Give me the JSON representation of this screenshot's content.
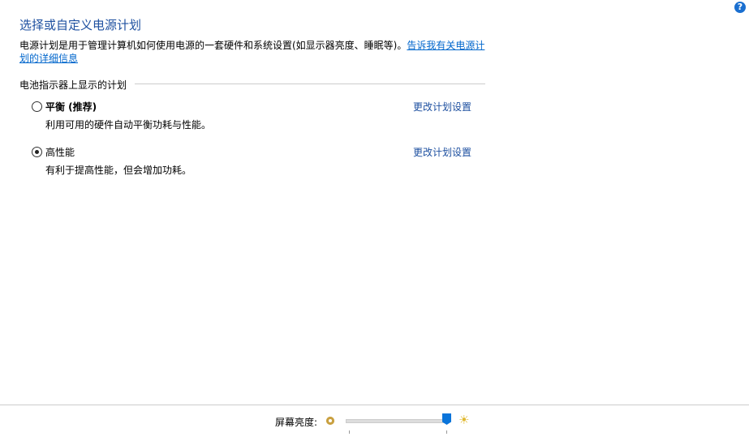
{
  "header": {
    "title": "选择或自定义电源计划",
    "help_icon": "?"
  },
  "description": {
    "text": "电源计划是用于管理计算机如何使用电源的一套硬件和系统设置(如显示器亮度、睡眠等)。",
    "link": "告诉我有关电源计划的详细信息"
  },
  "group": {
    "label": "电池指示器上显示的计划"
  },
  "plans": [
    {
      "name": "平衡 (推荐)",
      "description": "利用可用的硬件自动平衡功耗与性能。",
      "selected": false,
      "link": "更改计划设置"
    },
    {
      "name": "高性能",
      "description": "有利于提高性能，但会增加功耗。",
      "selected": true,
      "link": "更改计划设置"
    }
  ],
  "brightness": {
    "label": "屏幕亮度:",
    "value_percent": 100,
    "accent": "#0a74da"
  }
}
